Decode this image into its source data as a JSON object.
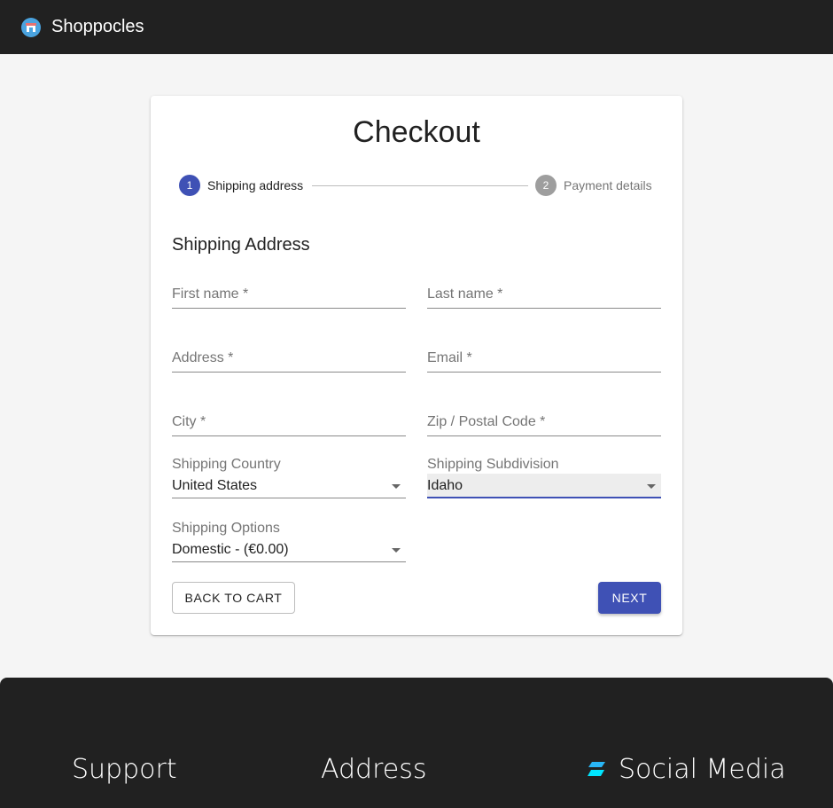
{
  "header": {
    "brand": "Shoppocles",
    "logo_icon": "store-icon"
  },
  "checkout": {
    "title": "Checkout",
    "steps": [
      {
        "number": "1",
        "label": "Shipping address",
        "active": true
      },
      {
        "number": "2",
        "label": "Payment details",
        "active": false
      }
    ],
    "section_title": "Shipping Address",
    "fields": {
      "first_name": "First name *",
      "last_name": "Last name *",
      "address": "Address *",
      "email": "Email *",
      "city": "City *",
      "zip": "Zip / Postal Code *"
    },
    "selects": {
      "country": {
        "label": "Shipping Country",
        "value": "United States"
      },
      "subdivision": {
        "label": "Shipping Subdivision",
        "value": "Idaho"
      },
      "options": {
        "label": "Shipping Options",
        "value": "Domestic - (€0.00)"
      }
    },
    "buttons": {
      "back": "BACK TO CART",
      "next": "NEXT"
    }
  },
  "footer": {
    "support": "Support",
    "address": "Address",
    "social": "Social Media"
  },
  "colors": {
    "primary": "#3f51b5",
    "appbar": "#212121"
  }
}
